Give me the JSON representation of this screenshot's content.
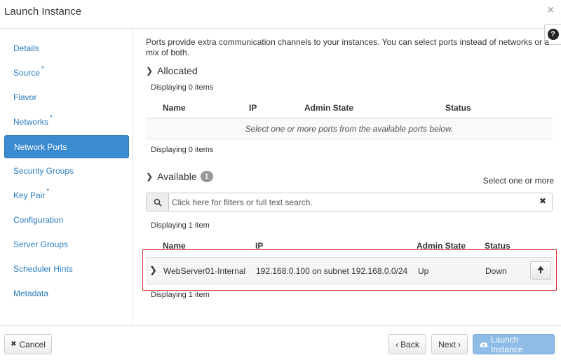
{
  "header": {
    "title": "Launch Instance",
    "close": "×",
    "help": "?"
  },
  "sidebar": {
    "items": [
      {
        "label": "Details",
        "required": false
      },
      {
        "label": "Source",
        "required": true
      },
      {
        "label": "Flavor",
        "required": false
      },
      {
        "label": "Networks",
        "required": true
      },
      {
        "label": "Network Ports",
        "required": false,
        "active": true
      },
      {
        "label": "Security Groups",
        "required": false
      },
      {
        "label": "Key Pair",
        "required": true
      },
      {
        "label": "Configuration",
        "required": false
      },
      {
        "label": "Server Groups",
        "required": false
      },
      {
        "label": "Scheduler Hints",
        "required": false
      },
      {
        "label": "Metadata",
        "required": false
      }
    ],
    "required_mark": "*"
  },
  "main": {
    "intro": "Ports provide extra communication channels to your instances. You can select ports instead of networks or a mix of both.",
    "allocated": {
      "title": "Allocated",
      "displaying_top": "Displaying 0 items",
      "columns": [
        "Name",
        "IP",
        "Admin State",
        "Status"
      ],
      "empty_message": "Select one or more ports from the available ports below.",
      "displaying_bottom": "Displaying 0 items"
    },
    "available": {
      "title": "Available",
      "count": "1",
      "select_hint": "Select one or more",
      "search_placeholder": "Click here for filters or full text search.",
      "displaying_top": "Displaying 1 item",
      "columns": [
        "Name",
        "IP",
        "Admin State",
        "Status"
      ],
      "rows": [
        {
          "name": "WebServer01-Internal",
          "ip": "192.168.0.100 on subnet 192.168.0.0/24",
          "admin_state": "Up",
          "status": "Down"
        }
      ],
      "displaying_bottom": "Displaying 1 item"
    }
  },
  "footer": {
    "cancel": "Cancel",
    "back": "Back",
    "next": "Next",
    "launch": "Launch Instance"
  },
  "colors": {
    "accent": "#3b8bd0",
    "link": "#2a7cc0",
    "highlight_border": "#d9322f",
    "launch_disabled": "#8fbce6"
  }
}
